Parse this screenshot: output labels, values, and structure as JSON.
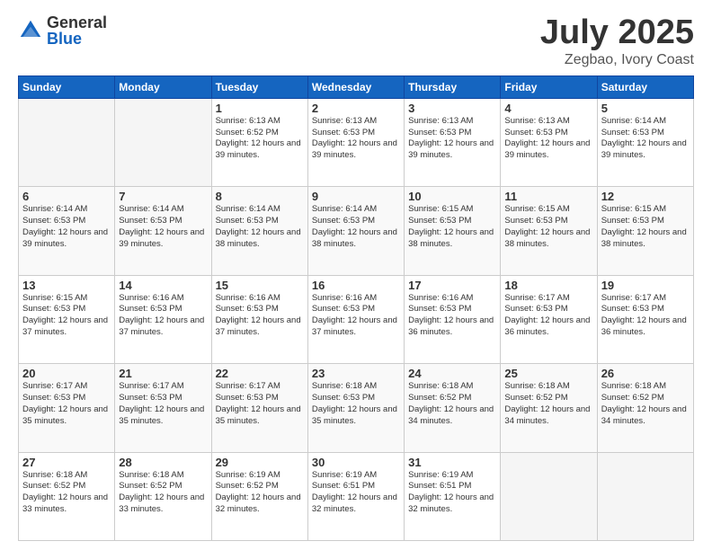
{
  "logo": {
    "general": "General",
    "blue": "Blue"
  },
  "title": "July 2025",
  "subtitle": "Zegbao, Ivory Coast",
  "days_of_week": [
    "Sunday",
    "Monday",
    "Tuesday",
    "Wednesday",
    "Thursday",
    "Friday",
    "Saturday"
  ],
  "weeks": [
    [
      {
        "day": "",
        "info": ""
      },
      {
        "day": "",
        "info": ""
      },
      {
        "day": "1",
        "info": "Sunrise: 6:13 AM\nSunset: 6:52 PM\nDaylight: 12 hours and 39 minutes."
      },
      {
        "day": "2",
        "info": "Sunrise: 6:13 AM\nSunset: 6:53 PM\nDaylight: 12 hours and 39 minutes."
      },
      {
        "day": "3",
        "info": "Sunrise: 6:13 AM\nSunset: 6:53 PM\nDaylight: 12 hours and 39 minutes."
      },
      {
        "day": "4",
        "info": "Sunrise: 6:13 AM\nSunset: 6:53 PM\nDaylight: 12 hours and 39 minutes."
      },
      {
        "day": "5",
        "info": "Sunrise: 6:14 AM\nSunset: 6:53 PM\nDaylight: 12 hours and 39 minutes."
      }
    ],
    [
      {
        "day": "6",
        "info": "Sunrise: 6:14 AM\nSunset: 6:53 PM\nDaylight: 12 hours and 39 minutes."
      },
      {
        "day": "7",
        "info": "Sunrise: 6:14 AM\nSunset: 6:53 PM\nDaylight: 12 hours and 39 minutes."
      },
      {
        "day": "8",
        "info": "Sunrise: 6:14 AM\nSunset: 6:53 PM\nDaylight: 12 hours and 38 minutes."
      },
      {
        "day": "9",
        "info": "Sunrise: 6:14 AM\nSunset: 6:53 PM\nDaylight: 12 hours and 38 minutes."
      },
      {
        "day": "10",
        "info": "Sunrise: 6:15 AM\nSunset: 6:53 PM\nDaylight: 12 hours and 38 minutes."
      },
      {
        "day": "11",
        "info": "Sunrise: 6:15 AM\nSunset: 6:53 PM\nDaylight: 12 hours and 38 minutes."
      },
      {
        "day": "12",
        "info": "Sunrise: 6:15 AM\nSunset: 6:53 PM\nDaylight: 12 hours and 38 minutes."
      }
    ],
    [
      {
        "day": "13",
        "info": "Sunrise: 6:15 AM\nSunset: 6:53 PM\nDaylight: 12 hours and 37 minutes."
      },
      {
        "day": "14",
        "info": "Sunrise: 6:16 AM\nSunset: 6:53 PM\nDaylight: 12 hours and 37 minutes."
      },
      {
        "day": "15",
        "info": "Sunrise: 6:16 AM\nSunset: 6:53 PM\nDaylight: 12 hours and 37 minutes."
      },
      {
        "day": "16",
        "info": "Sunrise: 6:16 AM\nSunset: 6:53 PM\nDaylight: 12 hours and 37 minutes."
      },
      {
        "day": "17",
        "info": "Sunrise: 6:16 AM\nSunset: 6:53 PM\nDaylight: 12 hours and 36 minutes."
      },
      {
        "day": "18",
        "info": "Sunrise: 6:17 AM\nSunset: 6:53 PM\nDaylight: 12 hours and 36 minutes."
      },
      {
        "day": "19",
        "info": "Sunrise: 6:17 AM\nSunset: 6:53 PM\nDaylight: 12 hours and 36 minutes."
      }
    ],
    [
      {
        "day": "20",
        "info": "Sunrise: 6:17 AM\nSunset: 6:53 PM\nDaylight: 12 hours and 35 minutes."
      },
      {
        "day": "21",
        "info": "Sunrise: 6:17 AM\nSunset: 6:53 PM\nDaylight: 12 hours and 35 minutes."
      },
      {
        "day": "22",
        "info": "Sunrise: 6:17 AM\nSunset: 6:53 PM\nDaylight: 12 hours and 35 minutes."
      },
      {
        "day": "23",
        "info": "Sunrise: 6:18 AM\nSunset: 6:53 PM\nDaylight: 12 hours and 35 minutes."
      },
      {
        "day": "24",
        "info": "Sunrise: 6:18 AM\nSunset: 6:52 PM\nDaylight: 12 hours and 34 minutes."
      },
      {
        "day": "25",
        "info": "Sunrise: 6:18 AM\nSunset: 6:52 PM\nDaylight: 12 hours and 34 minutes."
      },
      {
        "day": "26",
        "info": "Sunrise: 6:18 AM\nSunset: 6:52 PM\nDaylight: 12 hours and 34 minutes."
      }
    ],
    [
      {
        "day": "27",
        "info": "Sunrise: 6:18 AM\nSunset: 6:52 PM\nDaylight: 12 hours and 33 minutes."
      },
      {
        "day": "28",
        "info": "Sunrise: 6:18 AM\nSunset: 6:52 PM\nDaylight: 12 hours and 33 minutes."
      },
      {
        "day": "29",
        "info": "Sunrise: 6:19 AM\nSunset: 6:52 PM\nDaylight: 12 hours and 32 minutes."
      },
      {
        "day": "30",
        "info": "Sunrise: 6:19 AM\nSunset: 6:51 PM\nDaylight: 12 hours and 32 minutes."
      },
      {
        "day": "31",
        "info": "Sunrise: 6:19 AM\nSunset: 6:51 PM\nDaylight: 12 hours and 32 minutes."
      },
      {
        "day": "",
        "info": ""
      },
      {
        "day": "",
        "info": ""
      }
    ]
  ]
}
